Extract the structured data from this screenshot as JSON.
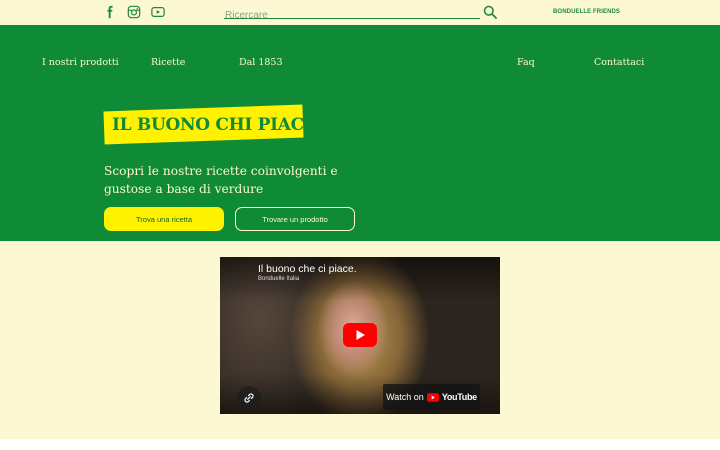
{
  "topbar": {
    "social": [
      {
        "name": "facebook-icon",
        "color": "#1f8a3a"
      },
      {
        "name": "instagram-icon",
        "color": "#1f8a3a"
      },
      {
        "name": "youtube-icon",
        "color": "#1f8a3a"
      }
    ],
    "search": {
      "placeholder": "Ricercare",
      "value": ""
    },
    "friends_label": "BONDUELLE FRIENDS"
  },
  "nav": {
    "items": [
      "I nostri prodotti",
      "Ricette",
      "Dal 1853",
      "Faq",
      "Contattaci"
    ]
  },
  "hero": {
    "headline": "IL BUONO CHI PIACE",
    "subtitle": "Scopri le nostre ricette coinvolgenti e gustose a base di verdure",
    "primary_button": "Trova una ricetta",
    "secondary_button": "Trovare un prodotto"
  },
  "video": {
    "title": "Il buono che ci piace.",
    "channel": "Bonduelle Italia",
    "watch_on": "Watch on",
    "platform": "YouTube",
    "play_icon": "play-icon",
    "share_icon": "link-icon"
  },
  "colors": {
    "brand_green": "#0f8a36",
    "brand_yellow": "#fff200",
    "cream": "#fdf8d4"
  }
}
